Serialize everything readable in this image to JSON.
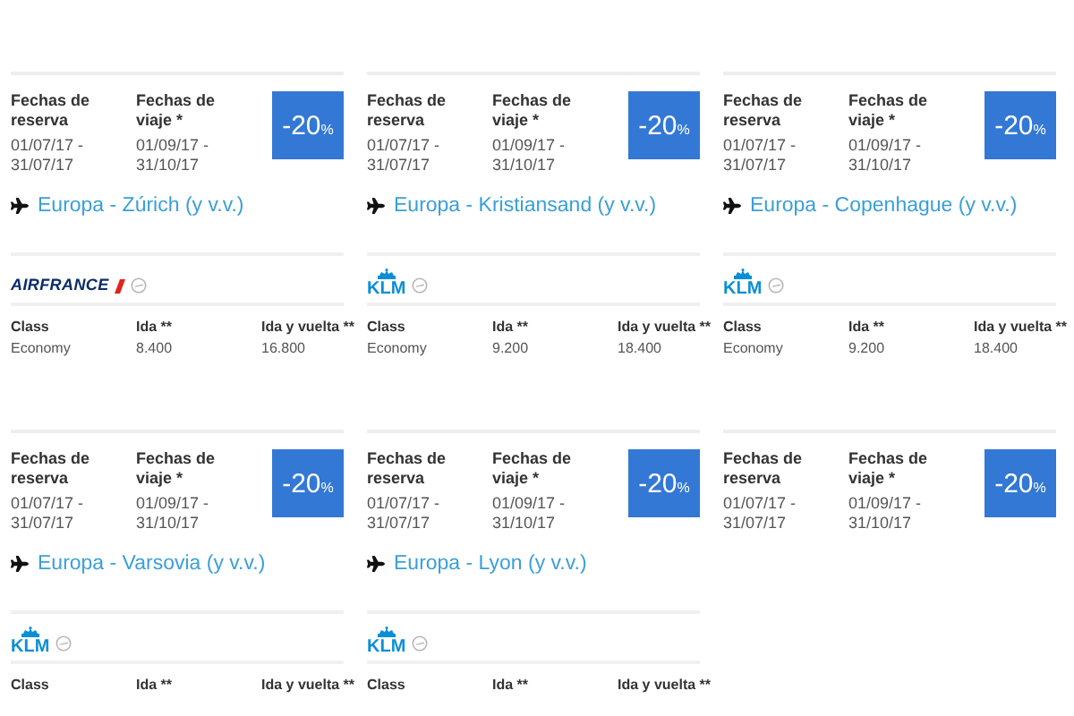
{
  "offers": [
    {
      "booking": {
        "label": "Fechas de reserva",
        "dates": "01/07/17 - 31/07/17"
      },
      "travel": {
        "label": "Fechas de viaje *",
        "dates": "01/09/17 - 31/10/17"
      },
      "discount": {
        "value": "-20",
        "unit": "%"
      },
      "route": "Europa - Zúrich (y v.v.)",
      "airline": {
        "kind": "airfrance",
        "logo": "AIRFRANCE"
      },
      "fares": {
        "columns": [
          "Class",
          "Ida **",
          "Ida y vuelta **"
        ],
        "row": [
          "Economy",
          "8.400",
          "16.800"
        ]
      }
    },
    {
      "booking": {
        "label": "Fechas de reserva",
        "dates": "01/07/17 - 31/07/17"
      },
      "travel": {
        "label": "Fechas de viaje *",
        "dates": "01/09/17 - 31/10/17"
      },
      "discount": {
        "value": "-20",
        "unit": "%"
      },
      "route": "Europa - Kristiansand (y v.v.)",
      "airline": {
        "kind": "klm",
        "logo": "KLM"
      },
      "fares": {
        "columns": [
          "Class",
          "Ida **",
          "Ida y vuelta **"
        ],
        "row": [
          "Economy",
          "9.200",
          "18.400"
        ]
      }
    },
    {
      "booking": {
        "label": "Fechas de reserva",
        "dates": "01/07/17 - 31/07/17"
      },
      "travel": {
        "label": "Fechas de viaje *",
        "dates": "01/09/17 - 31/10/17"
      },
      "discount": {
        "value": "-20",
        "unit": "%"
      },
      "route": "Europa - Copenhague (y v.v.)",
      "airline": {
        "kind": "klm",
        "logo": "KLM"
      },
      "fares": {
        "columns": [
          "Class",
          "Ida **",
          "Ida y vuelta **"
        ],
        "row": [
          "Economy",
          "9.200",
          "18.400"
        ]
      }
    },
    {
      "booking": {
        "label": "Fechas de reserva",
        "dates": "01/07/17 - 31/07/17"
      },
      "travel": {
        "label": "Fechas de viaje *",
        "dates": "01/09/17 - 31/10/17"
      },
      "discount": {
        "value": "-20",
        "unit": "%"
      },
      "route": "Europa - Varsovia (y v.v.)",
      "airline": {
        "kind": "klm",
        "logo": "KLM"
      },
      "fares": {
        "columns": [
          "Class",
          "Ida **",
          "Ida y vuelta **"
        ]
      }
    },
    {
      "booking": {
        "label": "Fechas de reserva",
        "dates": "01/07/17 - 31/07/17"
      },
      "travel": {
        "label": "Fechas de viaje *",
        "dates": "01/09/17 - 31/10/17"
      },
      "discount": {
        "value": "-20",
        "unit": "%"
      },
      "route": "Europa - Lyon (y v.v.)",
      "airline": {
        "kind": "klm",
        "logo": "KLM"
      },
      "fares": {
        "columns": [
          "Class",
          "Ida **",
          "Ida y vuelta **"
        ]
      }
    },
    {
      "booking": {
        "label": "Fechas de reserva",
        "dates": "01/07/17 - 31/07/17"
      },
      "travel": {
        "label": "Fechas de viaje *",
        "dates": "01/09/17 - 31/10/17"
      },
      "discount": {
        "value": "-20",
        "unit": "%"
      }
    }
  ]
}
